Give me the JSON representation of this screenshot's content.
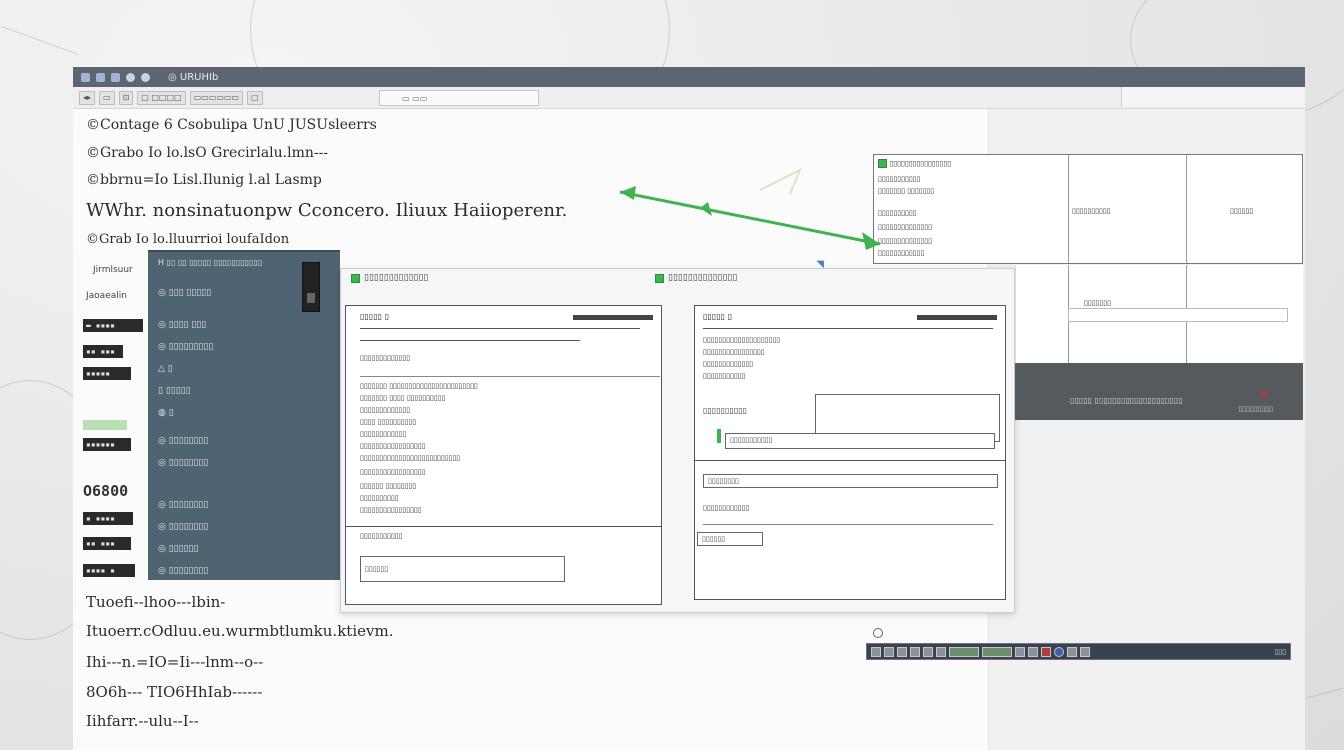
{
  "window": {
    "title": "⌂ ⓘ ∪∪∪△▷",
    "title_text": "◎ URUHIb",
    "toolbar_buttons": [
      "◂▸",
      "▭",
      "⊡",
      "□ □□□□",
      "▭▭▭▭▭▭",
      "▢"
    ],
    "url_text": "▭ ▭▭",
    "accent": "#3fb34f",
    "titlebar_color": "#5d6570"
  },
  "document": {
    "lines": [
      "©Contage 6 Csobulipa UnU JUSUsleerrs",
      "©Grabo Io lo.lsO Grecirlalu.lmn---",
      "©bbrnu=Io Lisl.Ilunig l.al Lasmp",
      "WWhr. nonsinatuonpw Cconcero. Iliuux Haiioperenr.",
      "©Grab Io lo.lluurrioi loufaIdon"
    ],
    "side_labels": [
      "Jirmlsuur",
      "Jaoaealin"
    ],
    "side_blocks": [
      "▬ ▪▪▪▪",
      "▪▪ ▪▪▪",
      "▪▪▪▪▪",
      "▪▪▪▪▪▪",
      "▪ ▪▪▪▪",
      "▪▪ ▪▪▪",
      "▪▪▪▪ ▪"
    ],
    "side_big": "O6800",
    "bottom_lines": [
      "Tuoefi--lhoo---lbin-",
      "Ituoerr.cOdluu.eu.wurmbtlumku.ktievm.",
      "Ihi---n.=IO=Ii---lnm--o--",
      "8O6h--- TIO6HhIab------",
      "Iihfarr.--ulu--I--"
    ]
  },
  "dark_panel": {
    "header": "H ▯▯ ▯▯ ▯▯▯▯▯ ▯▯▯▯▯▯▯▯▯▯▯",
    "items": [
      "◎ ▯▯▯ ▯▯▯▯▯",
      "◎ ▯▯▯▯ ▯▯▯",
      "◎ ▯▯▯▯▯▯▯▯▯",
      "△ ▯",
      "▯ ▯▯▯▯▯",
      "◍ ▯",
      "◎ ▯▯▯▯▯▯▯▯",
      "◎ ▯▯▯▯▯▯▯▯",
      "◎ ▯▯▯▯▯▯▯▯",
      "◎ ▯▯▯▯▯▯▯▯",
      "◎ ▯▯▯▯▯▯",
      "◎ ▯▯▯▯▯▯▯▯"
    ]
  },
  "dialog": {
    "left_title": "▯▯▯▯▯▯▯▯▯▯▯▯▯",
    "right_title": "▯▯▯▯▯▯▯▯▯▯▯▯▯▯",
    "left_form": {
      "heading": "▯▯▯▯▯ ▯",
      "rows": [
        "▯▯▯▯▯▯▯▯▯▯▯▯▯",
        "▯▯▯▯▯▯▯ ▯▯▯▯▯▯▯▯▯▯▯▯▯▯▯▯▯▯▯▯▯▯▯",
        "▯▯▯▯▯▯▯ ▯▯▯▯ ▯▯▯▯▯▯▯▯▯▯",
        "▯▯▯▯▯▯▯▯▯▯▯▯▯",
        "▯▯▯▯ ▯▯▯▯▯▯▯▯▯▯",
        "▯▯▯▯▯▯▯▯▯▯▯▯",
        "▯▯▯▯▯▯▯▯▯▯▯▯▯▯▯▯▯",
        "▯▯▯▯▯▯▯▯▯▯▯▯▯▯▯▯▯▯▯▯▯▯▯▯▯▯",
        "▯▯▯▯▯▯▯▯▯▯▯▯▯▯▯▯▯",
        "▯▯▯▯▯▯ ▯▯▯▯▯▯▯▯",
        "▯▯▯▯▯▯▯▯▯▯",
        "▯▯▯▯▯▯▯▯▯▯▯▯▯▯▯▯"
      ],
      "section": "▯▯▯▯▯▯▯▯▯▯▯",
      "field_value": "▯▯▯▯▯▯"
    },
    "right_form": {
      "heading": "▯▯▯▯▯ ▯",
      "rows": [
        "▯▯▯▯▯▯▯▯▯▯▯▯▯▯▯▯▯▯▯▯",
        "▯▯▯▯▯▯▯▯▯▯▯▯▯▯▯▯",
        "▯▯▯▯▯▯▯▯▯▯▯▯▯",
        "▯▯▯▯▯▯▯▯▯▯▯",
        "▯▯▯▯▯▯▯▯",
        "▯▯▯▯▯▯▯▯▯▯▯▯"
      ],
      "bold_row": "▯▯▯▯▯▯▯▯▯▯",
      "field_value": "▯▯▯▯▯▯▯▯▯▯▯",
      "button_label": "▯▯▯▯▯▯"
    }
  },
  "table_panel": {
    "rows": [
      "▯▯▯▯▯▯▯▯▯▯▯▯▯▯▯▯",
      "▯▯▯▯▯▯▯▯▯▯▯",
      "▯▯▯▯▯▯▯ ▯▯▯▯▯▯▯",
      "▯▯▯▯▯▯▯▯▯▯",
      "▯▯▯▯▯▯▯▯▯▯▯▯▯▯",
      "▯▯▯▯▯▯▯▯▯▯▯▯▯▯",
      "▯▯▯▯▯▯▯▯▯▯▯▯"
    ],
    "mid_cell": "▯▯▯▯▯▯▯▯▯▯",
    "right_cell": "▯▯▯▯▯▯",
    "lower_cell": "▯▯▯▯▯▯▯",
    "strip_caption": "▯▯▯▯▯ ▯▯▯▯▯▯▯▯▯▯▯▯▯▯▯▯▯▯▯▯",
    "strip_caption_right": "▯▯▯▯▯▯▯▯▯"
  },
  "taskbar": {
    "tray_text": "▯▯▯"
  }
}
